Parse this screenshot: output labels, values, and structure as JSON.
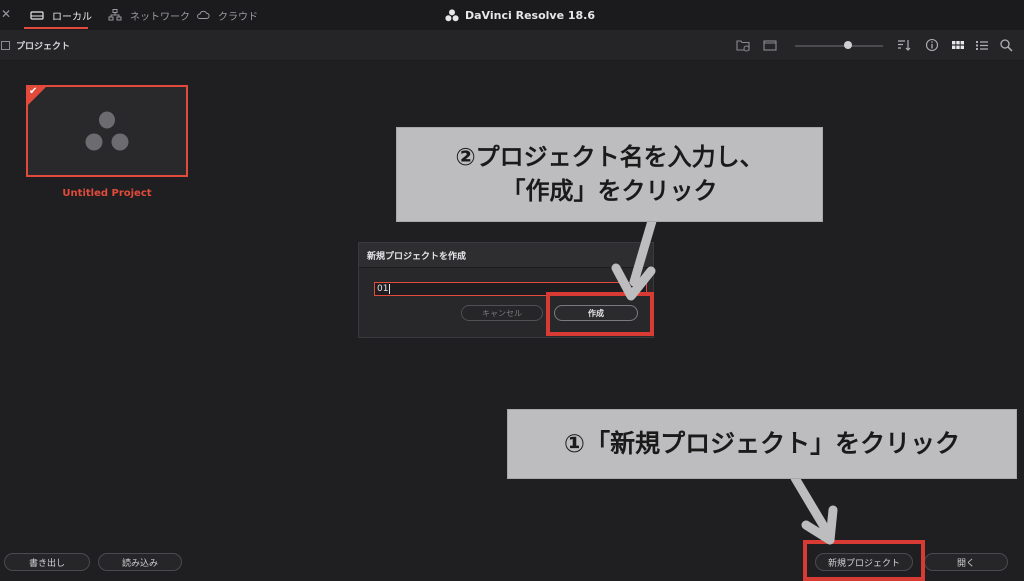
{
  "window": {
    "close_glyph": "✕",
    "app_title": "DaVinci Resolve 18.6"
  },
  "tabs": [
    {
      "label": "ローカル",
      "icon": "hard-drive-icon",
      "active": true
    },
    {
      "label": "ネットワーク",
      "icon": "network-icon",
      "active": false
    },
    {
      "label": "クラウド",
      "icon": "cloud-icon",
      "active": false
    }
  ],
  "toolbar": {
    "section_label": "プロジェクト",
    "icons": [
      "new-folder-icon",
      "window-icon",
      "sort-icon",
      "info-icon",
      "grid-view-icon",
      "list-view-icon",
      "search-icon"
    ]
  },
  "project_card": {
    "name": "Untitled Project",
    "selected": true
  },
  "dialog": {
    "title": "新規プロジェクトを作成",
    "input_value": "01",
    "cancel_label": "キャンセル",
    "create_label": "作成"
  },
  "callouts": {
    "step2_line1": "②プロジェクト名を入力し、",
    "step2_line2": "「作成」をクリック",
    "step1": "①「新規プロジェクト」をクリック"
  },
  "bottom": {
    "export_label": "書き出し",
    "import_label": "読み込み",
    "new_project_label": "新規プロジェクト",
    "open_label": "開く"
  },
  "colors": {
    "accent": "#e24a3b",
    "highlight": "#d83a34",
    "callout_bg": "#bdbdbf"
  }
}
